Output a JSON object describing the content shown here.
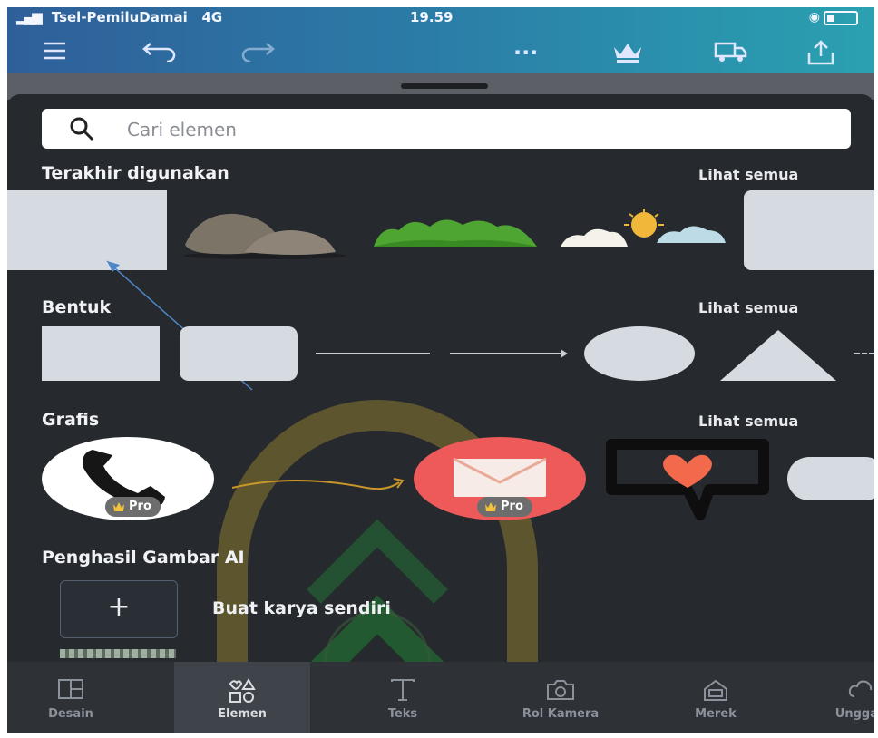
{
  "status_bar": {
    "carrier": "Tsel-PemiluDamai",
    "network": "4G",
    "time": "19.59"
  },
  "toolbar": {
    "icons": [
      "menu-icon",
      "undo-icon",
      "redo-icon",
      "more-icon",
      "crown-icon",
      "truck-icon",
      "share-icon"
    ],
    "more_label": "···"
  },
  "search": {
    "placeholder": "Cari elemen",
    "value": ""
  },
  "sections": {
    "recent": {
      "title": "Terakhir digunakan",
      "see_all": "Lihat semua"
    },
    "shapes": {
      "title": "Bentuk",
      "see_all": "Lihat semua"
    },
    "graphics": {
      "title": "Grafis",
      "see_all": "Lihat semua",
      "items": [
        {
          "icon": "phone-icon",
          "badge": "Pro"
        },
        {
          "icon": "arrow-swoosh-icon"
        },
        {
          "icon": "mail-icon",
          "badge": "Pro"
        },
        {
          "icon": "heart-speech-icon"
        }
      ]
    },
    "ai": {
      "title": "Penghasil Gambar AI",
      "create_label": "Buat karya sendiri",
      "plus": "+"
    }
  },
  "bottom_nav": [
    {
      "label": "Desain",
      "icon": "layout-icon",
      "active": false
    },
    {
      "label": "Elemen",
      "icon": "elements-icon",
      "active": true
    },
    {
      "label": "Teks",
      "icon": "text-icon",
      "active": false
    },
    {
      "label": "Rol Kamera",
      "icon": "camera-icon",
      "active": false
    },
    {
      "label": "Merek",
      "icon": "brand-icon",
      "active": false
    },
    {
      "label": "Unggah",
      "icon": "upload-icon",
      "active": false
    }
  ],
  "colors": {
    "sheet_bg": "#26292e",
    "accent_red": "#ee5a5a",
    "shape_fill": "#d6dbe1",
    "heart": "#f26a4b"
  }
}
